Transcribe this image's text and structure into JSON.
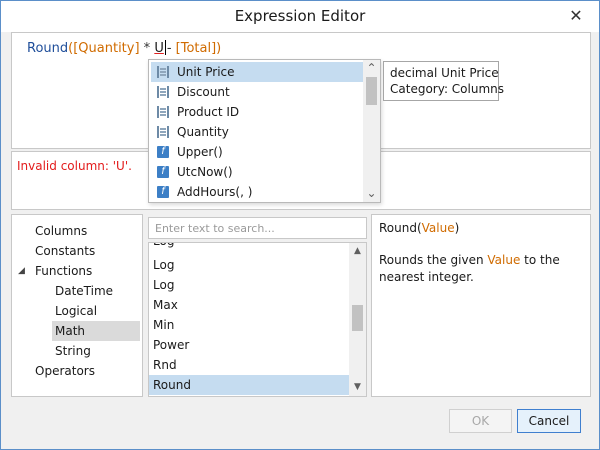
{
  "window": {
    "title": "Expression Editor",
    "close_glyph": "✕"
  },
  "expression": {
    "tokens": {
      "fn": "Round",
      "open": "(",
      "col1": "[Quantity]",
      "op1": " * ",
      "err": "U",
      "op2": "- ",
      "col2": "[Total]",
      "close": ")"
    }
  },
  "error": {
    "message": "Invalid column: 'U'."
  },
  "autocomplete": {
    "items": [
      {
        "label": "Unit Price",
        "icon": "column-icon",
        "selected": true
      },
      {
        "label": "Discount",
        "icon": "column-icon",
        "selected": false
      },
      {
        "label": "Product ID",
        "icon": "column-icon",
        "selected": false
      },
      {
        "label": "Quantity",
        "icon": "column-icon",
        "selected": false
      },
      {
        "label": "Upper()",
        "icon": "function-icon",
        "selected": false
      },
      {
        "label": "UtcNow()",
        "icon": "function-icon",
        "selected": false
      },
      {
        "label": "AddHours(, )",
        "icon": "function-icon",
        "selected": false
      }
    ],
    "function_glyph": "f"
  },
  "tooltip": {
    "line1": "decimal Unit Price",
    "line2": "Category: Columns"
  },
  "tree": {
    "items": [
      {
        "label": "Columns",
        "level": 0,
        "expanded": false,
        "selected": false
      },
      {
        "label": "Constants",
        "level": 0,
        "expanded": false,
        "selected": false
      },
      {
        "label": "Functions",
        "level": 0,
        "expanded": true,
        "selected": false
      },
      {
        "label": "DateTime",
        "level": 1,
        "expanded": false,
        "selected": false
      },
      {
        "label": "Logical",
        "level": 1,
        "expanded": false,
        "selected": false
      },
      {
        "label": "Math",
        "level": 1,
        "expanded": false,
        "selected": true
      },
      {
        "label": "String",
        "level": 1,
        "expanded": false,
        "selected": false
      },
      {
        "label": "Operators",
        "level": 0,
        "expanded": false,
        "selected": false
      }
    ],
    "expand_glyph": "◢"
  },
  "search": {
    "placeholder": "Enter text to search...",
    "value": ""
  },
  "functions": {
    "items": [
      {
        "label": "Log",
        "selected": false
      },
      {
        "label": "Log",
        "selected": false
      },
      {
        "label": "Log",
        "selected": false
      },
      {
        "label": "Max",
        "selected": false
      },
      {
        "label": "Min",
        "selected": false
      },
      {
        "label": "Power",
        "selected": false
      },
      {
        "label": "Rnd",
        "selected": false
      },
      {
        "label": "Round",
        "selected": true
      }
    ]
  },
  "scroll": {
    "up_glyph": "▲",
    "down_glyph": "▼",
    "chevron_up": "⌃",
    "chevron_down": "⌄"
  },
  "description": {
    "sig_fn": "Round",
    "sig_open": "(",
    "sig_param": "Value",
    "sig_close": ")",
    "body_pre": "Rounds the given ",
    "body_param": "Value",
    "body_post": " to the nearest integer."
  },
  "buttons": {
    "ok_label": "OK",
    "ok_enabled": false,
    "cancel_label": "Cancel"
  }
}
